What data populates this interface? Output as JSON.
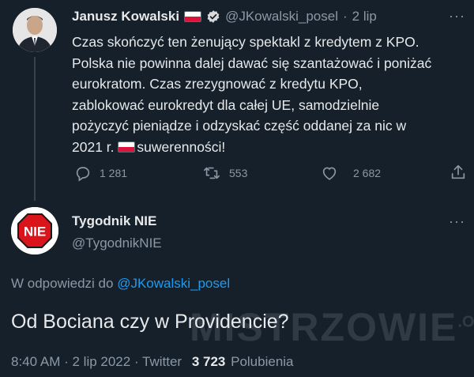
{
  "tweet1": {
    "author_name": "Janusz Kowalski",
    "handle": "@JKowalski_posel",
    "separator": "·",
    "date": "2 lip",
    "more": "···",
    "text_line1": "Czas skończyć ten żenujący spektakl z kredytem z KPO.",
    "text_line2": "Polska nie powinna dalej dawać się szantażować i poniżać",
    "text_line3": "eurokratom. Czas zrezygnować z kredytu KPO,",
    "text_line4": "zablokować eurokredyt dla całej UE, samodzielnie",
    "text_line5": "pożyczyć pieniądze i odzyskać część oddanej za nic w",
    "text_line6_a": "2021 r. ",
    "text_line6_b": "suwerenności!",
    "replies": "1 281",
    "retweets": "553",
    "likes": "2 682"
  },
  "tweet2": {
    "author_name": "Tygodnik NIE",
    "handle": "@TygodnikNIE",
    "avatar_text": "NIE",
    "more": "···",
    "reply_prefix": "W odpowiedzi do ",
    "reply_handle": "@JKowalski_posel",
    "text": "Od Bociana czy w Providencie?",
    "time": "8:40 AM",
    "dot": " · ",
    "date": "2 lip 2022",
    "source": "Twitter",
    "likes_count": "3 723",
    "likes_label": "Polubienia"
  },
  "watermark": {
    "main": "MISTRZOWIE",
    "suffix": ".ORG"
  },
  "colors": {
    "background": "#15202b",
    "muted": "#8b98a5",
    "link": "#1d9bf0",
    "verified": "#d9d9d9"
  }
}
